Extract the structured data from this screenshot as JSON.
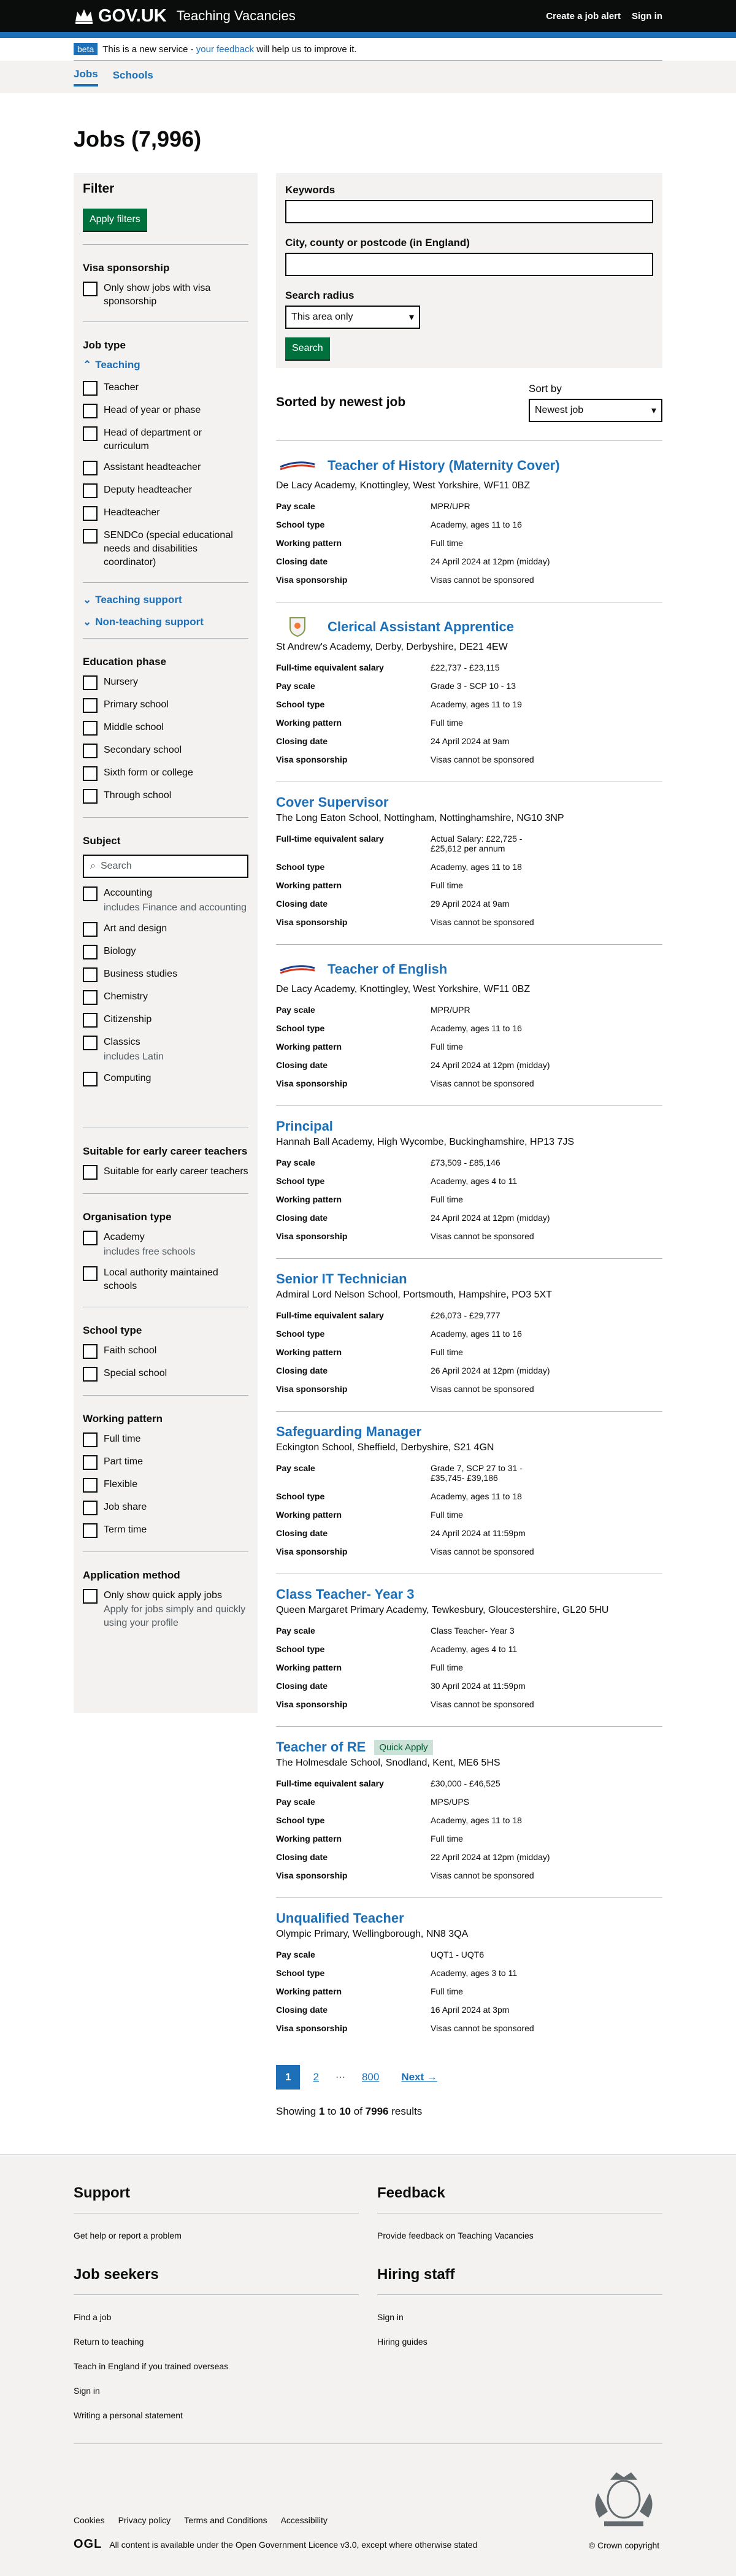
{
  "header": {
    "logo": "GOV.UK",
    "service": "Teaching Vacancies",
    "nav": [
      "Create a job alert",
      "Sign in"
    ]
  },
  "phase": {
    "tag": "beta",
    "before": "This is a new service -",
    "link": "your feedback",
    "after": "will help us to improve it."
  },
  "subnav": [
    "Jobs",
    "Schools"
  ],
  "page_title": "Jobs (7,996)",
  "filter": {
    "title": "Filter",
    "apply": "Apply filters",
    "visa": {
      "heading": "Visa sponsorship",
      "option": "Only show jobs with visa sponsorship"
    },
    "job_type": {
      "heading": "Job type",
      "teaching": "Teaching",
      "options": [
        "Teacher",
        "Head of year or phase",
        "Head of department or curriculum",
        "Assistant headteacher",
        "Deputy headteacher",
        "Headteacher",
        "SENDCo (special educational needs and disabilities coordinator)"
      ],
      "teaching_support": "Teaching support",
      "non_teaching_support": "Non-teaching support"
    },
    "education_phase": {
      "heading": "Education phase",
      "options": [
        "Nursery",
        "Primary school",
        "Middle school",
        "Secondary school",
        "Sixth form or college",
        "Through school"
      ]
    },
    "subject": {
      "heading": "Subject",
      "placeholder": "Search",
      "options": [
        {
          "label": "Accounting",
          "hint": "includes Finance and accounting"
        },
        {
          "label": "Art and design"
        },
        {
          "label": "Biology"
        },
        {
          "label": "Business studies"
        },
        {
          "label": "Chemistry"
        },
        {
          "label": "Citizenship"
        },
        {
          "label": "Classics",
          "hint": "includes Latin"
        },
        {
          "label": "Computing"
        }
      ]
    },
    "ect": {
      "heading": "Suitable for early career teachers",
      "option": "Suitable for early career teachers"
    },
    "org": {
      "heading": "Organisation type",
      "academy": "Academy",
      "academy_hint": "includes free schools",
      "la": "Local authority maintained schools"
    },
    "school_type": {
      "heading": "School type",
      "options": [
        "Faith school",
        "Special school"
      ]
    },
    "working": {
      "heading": "Working pattern",
      "options": [
        "Full time",
        "Part time",
        "Flexible",
        "Job share",
        "Term time"
      ]
    },
    "app": {
      "heading": "Application method",
      "option": "Only show quick apply jobs",
      "hint": "Apply for jobs simply and quickly using your profile"
    }
  },
  "search": {
    "keywords": "Keywords",
    "location": "City, county or postcode (in England)",
    "radius_label": "Search radius",
    "radius_value": "This area only",
    "button": "Search"
  },
  "sort": {
    "heading": "Sorted by newest job",
    "label": "Sort by",
    "value": "Newest job"
  },
  "jobs": [
    {
      "title": "Teacher of History (Maternity Cover)",
      "address": "De Lacy Academy, Knottingley, West Yorkshire, WF11 0BZ",
      "logo": "delacy",
      "rows": [
        [
          "Pay scale",
          "MPR/UPR"
        ],
        [
          "School type",
          "Academy, ages 11 to 16"
        ],
        [
          "Working pattern",
          "Full time"
        ],
        [
          "Closing date",
          "24 April 2024 at 12pm (midday)"
        ],
        [
          "Visa sponsorship",
          "Visas cannot be sponsored"
        ]
      ]
    },
    {
      "title": "Clerical Assistant Apprentice",
      "address": "St Andrew's Academy, Derby, Derbyshire, DE21 4EW",
      "logo": "crest",
      "rows": [
        [
          "Full-time equivalent salary",
          "£22,737 - £23,115"
        ],
        [
          "Pay scale",
          "Grade 3 - SCP 10 - 13"
        ],
        [
          "School type",
          "Academy, ages 11 to 19"
        ],
        [
          "Working pattern",
          "Full time"
        ],
        [
          "Closing date",
          "24 April 2024 at 9am"
        ],
        [
          "Visa sponsorship",
          "Visas cannot be sponsored"
        ]
      ]
    },
    {
      "title": "Cover Supervisor",
      "address": "The Long Eaton School, Nottingham, Nottinghamshire, NG10 3NP",
      "rows": [
        [
          "Full-time equivalent salary",
          "Actual Salary: £22,725 - £25,612 per annum"
        ],
        [
          "School type",
          "Academy, ages 11 to 18"
        ],
        [
          "Working pattern",
          "Full time"
        ],
        [
          "Closing date",
          "29 April 2024 at 9am"
        ],
        [
          "Visa sponsorship",
          "Visas cannot be sponsored"
        ]
      ]
    },
    {
      "title": "Teacher of English",
      "address": "De Lacy Academy, Knottingley, West Yorkshire, WF11 0BZ",
      "logo": "delacy",
      "rows": [
        [
          "Pay scale",
          "MPR/UPR"
        ],
        [
          "School type",
          "Academy, ages 11 to 16"
        ],
        [
          "Working pattern",
          "Full time"
        ],
        [
          "Closing date",
          "24 April 2024 at 12pm (midday)"
        ],
        [
          "Visa sponsorship",
          "Visas cannot be sponsored"
        ]
      ]
    },
    {
      "title": "Principal",
      "address": "Hannah Ball Academy, High Wycombe, Buckinghamshire, HP13 7JS",
      "rows": [
        [
          "Pay scale",
          "£73,509 - £85,146"
        ],
        [
          "School type",
          "Academy, ages 4 to 11"
        ],
        [
          "Working pattern",
          "Full time"
        ],
        [
          "Closing date",
          "24 April 2024 at 12pm (midday)"
        ],
        [
          "Visa sponsorship",
          "Visas cannot be sponsored"
        ]
      ]
    },
    {
      "title": "Senior IT Technician",
      "address": "Admiral Lord Nelson School, Portsmouth, Hampshire, PO3 5XT",
      "rows": [
        [
          "Full-time equivalent salary",
          "£26,073 - £29,777"
        ],
        [
          "School type",
          "Academy, ages 11 to 16"
        ],
        [
          "Working pattern",
          "Full time"
        ],
        [
          "Closing date",
          "26 April 2024 at 12pm (midday)"
        ],
        [
          "Visa sponsorship",
          "Visas cannot be sponsored"
        ]
      ]
    },
    {
      "title": "Safeguarding Manager",
      "address": "Eckington School, Sheffield, Derbyshire, S21 4GN",
      "rows": [
        [
          "Pay scale",
          "Grade 7, SCP 27 to 31 - £35,745- £39,186"
        ],
        [
          "School type",
          "Academy, ages 11 to 18"
        ],
        [
          "Working pattern",
          "Full time"
        ],
        [
          "Closing date",
          "24 April 2024 at 11:59pm"
        ],
        [
          "Visa sponsorship",
          "Visas cannot be sponsored"
        ]
      ]
    },
    {
      "title": "Class Teacher- Year 3",
      "address": "Queen Margaret Primary Academy, Tewkesbury, Gloucestershire, GL20 5HU",
      "rows": [
        [
          "Pay scale",
          "Class Teacher- Year 3"
        ],
        [
          "School type",
          "Academy, ages 4 to 11"
        ],
        [
          "Working pattern",
          "Full time"
        ],
        [
          "Closing date",
          "30 April 2024 at 11:59pm"
        ],
        [
          "Visa sponsorship",
          "Visas cannot be sponsored"
        ]
      ]
    },
    {
      "title": "Teacher of RE",
      "badge": "Quick Apply",
      "address": "The Holmesdale School, Snodland, Kent, ME6 5HS",
      "rows": [
        [
          "Full-time equivalent salary",
          "£30,000 - £46,525"
        ],
        [
          "Pay scale",
          "MPS/UPS"
        ],
        [
          "School type",
          "Academy, ages 11 to 18"
        ],
        [
          "Working pattern",
          "Full time"
        ],
        [
          "Closing date",
          "22 April 2024 at 12pm (midday)"
        ],
        [
          "Visa sponsorship",
          "Visas cannot be sponsored"
        ]
      ]
    },
    {
      "title": "Unqualified Teacher",
      "address": "Olympic Primary, Wellingborough, NN8 3QA",
      "rows": [
        [
          "Pay scale",
          "UQT1 - UQT6"
        ],
        [
          "School type",
          "Academy, ages 3 to 11"
        ],
        [
          "Working pattern",
          "Full time"
        ],
        [
          "Closing date",
          "16 April 2024 at 3pm"
        ],
        [
          "Visa sponsorship",
          "Visas cannot be sponsored"
        ]
      ]
    }
  ],
  "pagination": {
    "pages": [
      "1",
      "2",
      "800"
    ],
    "ellipsis": "⋯",
    "next": "Next"
  },
  "showing": {
    "a": "Showing",
    "from": "1",
    "to_word": "to",
    "to": "10",
    "of_word": "of",
    "total": "7996",
    "results": "results"
  },
  "footer": {
    "support": {
      "heading": "Support",
      "links": [
        "Get help or report a problem"
      ]
    },
    "feedback": {
      "heading": "Feedback",
      "links": [
        "Provide feedback on Teaching Vacancies"
      ]
    },
    "job_seekers": {
      "heading": "Job seekers",
      "links": [
        "Find a job",
        "Return to teaching",
        "Teach in England if you trained overseas",
        "Sign in",
        "Writing a personal statement"
      ]
    },
    "hiring": {
      "heading": "Hiring staff",
      "links": [
        "Sign in",
        "Hiring guides"
      ]
    },
    "meta_links": [
      "Cookies",
      "Privacy policy",
      "Terms and Conditions",
      "Accessibility"
    ],
    "ogl": "OGL",
    "licence_before": "All content is available under the",
    "licence_link": "Open Government Licence v3.0",
    "licence_after": ", except where otherwise stated",
    "copyright": "© Crown copyright"
  },
  "colors": {
    "brand": "#1d70b8",
    "button": "#00703c",
    "text": "#0b0c0c"
  }
}
